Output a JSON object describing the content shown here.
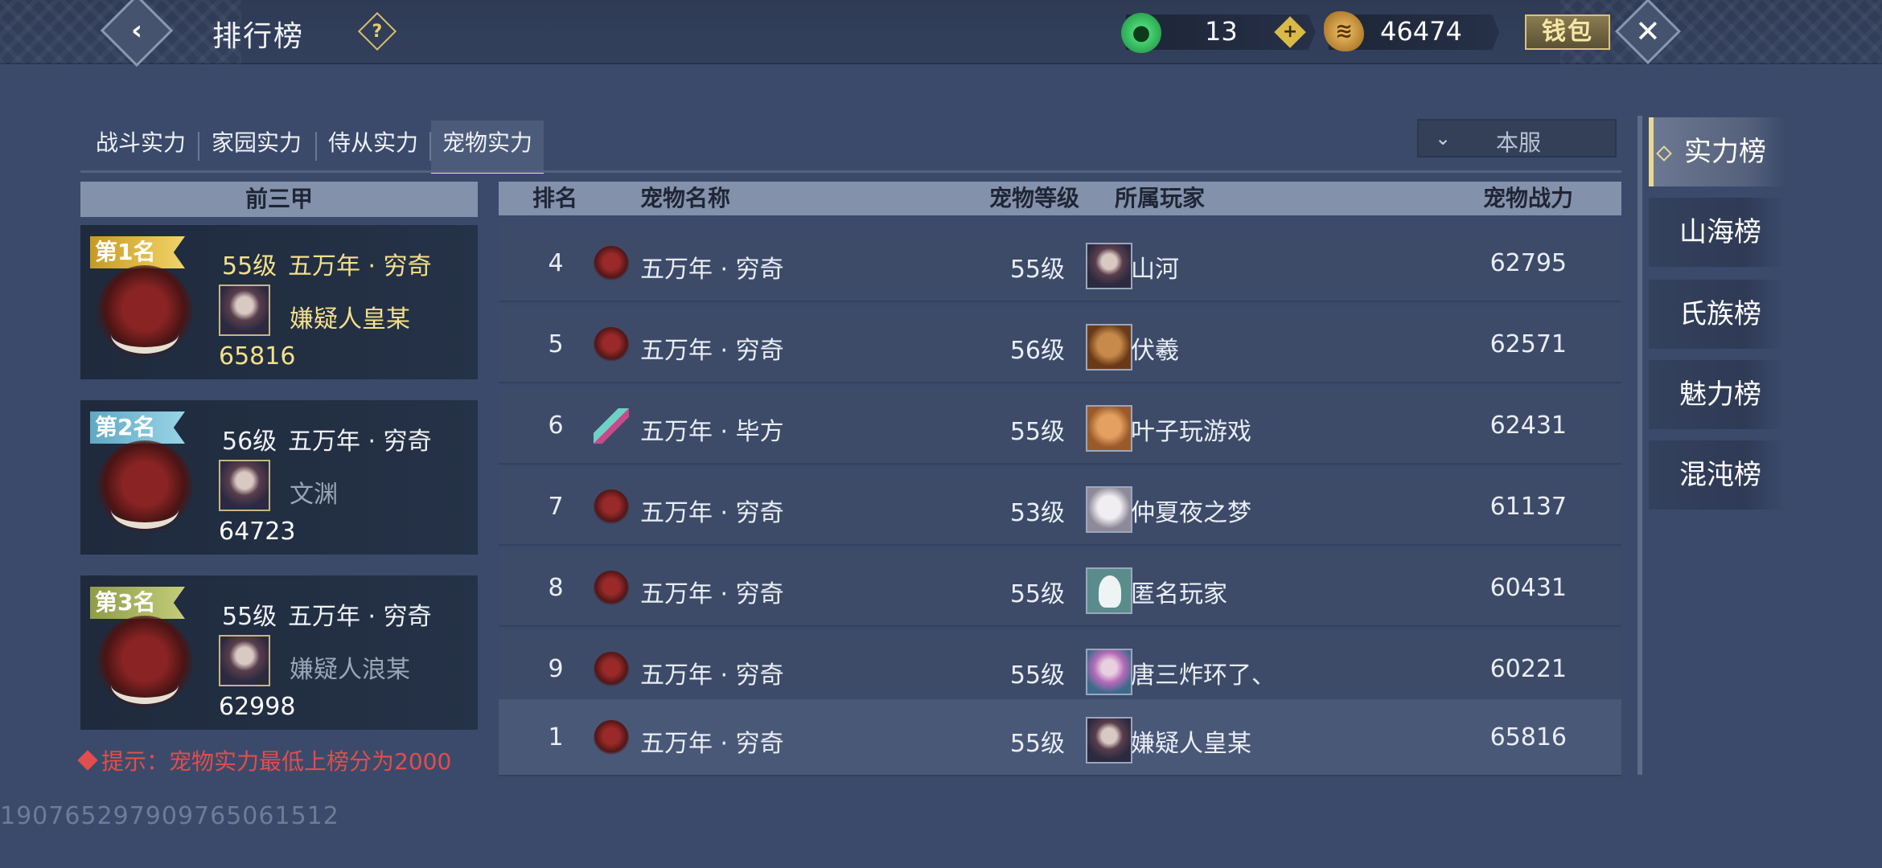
{
  "header": {
    "title": "排行榜",
    "back_icon": "‹",
    "help_icon": "?",
    "jade_value": "13",
    "gold_value": "46474",
    "wallet_label": "钱包",
    "close_icon": "✕"
  },
  "tabs": [
    {
      "label": "战斗实力",
      "active": false
    },
    {
      "label": "家园实力",
      "active": false
    },
    {
      "label": "侍从实力",
      "active": false
    },
    {
      "label": "宠物实力",
      "active": true
    }
  ],
  "server_select": {
    "value": "本服"
  },
  "rank_nav": [
    {
      "label": "实力榜",
      "active": true
    },
    {
      "label": "山海榜",
      "active": false
    },
    {
      "label": "氏族榜",
      "active": false
    },
    {
      "label": "魅力榜",
      "active": false
    },
    {
      "label": "混沌榜",
      "active": false
    }
  ],
  "top3": {
    "header": "前三甲",
    "cards": [
      {
        "badge": "第1名",
        "level": "55级",
        "pet": "五万年 · 穷奇",
        "player": "嫌疑人皇某",
        "power": "65816"
      },
      {
        "badge": "第2名",
        "level": "56级",
        "pet": "五万年 · 穷奇",
        "player": "文渊",
        "power": "64723"
      },
      {
        "badge": "第3名",
        "level": "55级",
        "pet": "五万年 · 穷奇",
        "player": "嫌疑人浪某",
        "power": "62998"
      }
    ],
    "tip": "提示：宠物实力最低上榜分为2000"
  },
  "table": {
    "headers": {
      "rank": "排名",
      "pet": "宠物名称",
      "level": "宠物等级",
      "player": "所属玩家",
      "power": "宠物战力"
    },
    "rows": [
      {
        "rank": "4",
        "pet": "五万年 · 穷奇",
        "level": "55级",
        "player": "山河",
        "power": "62795"
      },
      {
        "rank": "5",
        "pet": "五万年 · 穷奇",
        "level": "56级",
        "player": "伏羲",
        "power": "62571"
      },
      {
        "rank": "6",
        "pet": "五万年 · 毕方",
        "level": "55级",
        "player": "叶子玩游戏",
        "power": "62431"
      },
      {
        "rank": "7",
        "pet": "五万年 · 穷奇",
        "level": "53级",
        "player": "仲夏夜之梦",
        "power": "61137"
      },
      {
        "rank": "8",
        "pet": "五万年 · 穷奇",
        "level": "55级",
        "player": "匿名玩家",
        "power": "60431"
      },
      {
        "rank": "9",
        "pet": "五万年 · 穷奇",
        "level": "55级",
        "player": "唐三炸环了、",
        "power": "60221"
      }
    ],
    "my_row": {
      "rank": "1",
      "pet": "五万年 · 穷奇",
      "level": "55级",
      "player": "嫌疑人皇某",
      "power": "65816"
    }
  },
  "uid": "190765297909765061512",
  "colors": {
    "accent_gold": "#f3e08a",
    "tip_red": "#e24d4d",
    "header_bar": "#8391ab"
  }
}
